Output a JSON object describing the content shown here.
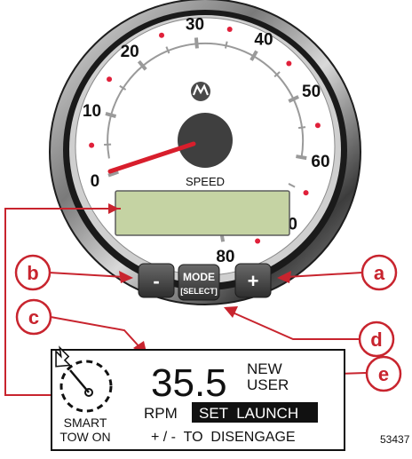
{
  "gauge": {
    "label": "SPEED",
    "scale_min": 0,
    "scale_max": 80,
    "needle_value": 0,
    "ticks": [
      {
        "label": "0"
      },
      {
        "label": "10"
      },
      {
        "label": "20"
      },
      {
        "label": "30"
      },
      {
        "label": "40"
      },
      {
        "label": "50"
      },
      {
        "label": "60"
      },
      {
        "label": "70"
      },
      {
        "label": "80"
      }
    ],
    "dot_color": "#e0203a",
    "needle_color": "#d81e2c",
    "lcd_color": "#c5d3a3"
  },
  "buttons": {
    "minus": "-",
    "plus": "+",
    "mode_line1": "MODE",
    "mode_line2": "[SELECT]"
  },
  "callouts": {
    "a": "a",
    "b": "b",
    "c": "c",
    "d": "d",
    "e": "e",
    "color": "#c8242e"
  },
  "display": {
    "speed_value": "35.5",
    "new_user_line1": "NEW",
    "new_user_line2": "USER",
    "status_line1": "SMART",
    "status_line2": "TOW ON",
    "rpm_label": "RPM",
    "set_launch": "SET  LAUNCH",
    "disengage": "+ / -  TO  DISENGAGE"
  },
  "figure_id": "53437"
}
